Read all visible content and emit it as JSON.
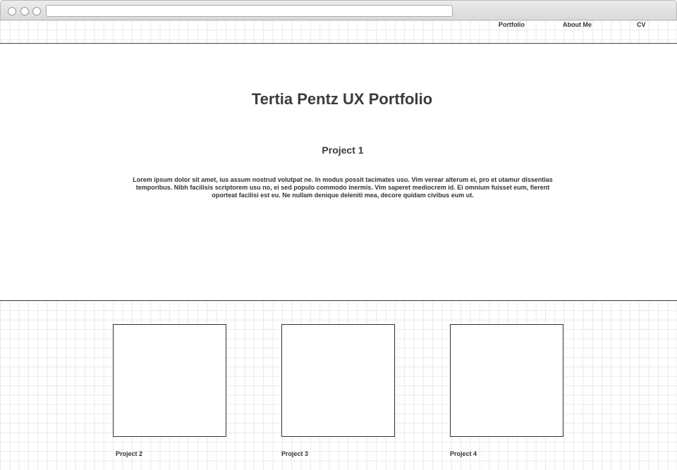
{
  "nav": {
    "portfolio": "Portfolio",
    "about": "About Me",
    "cv": "CV"
  },
  "hero": {
    "title": "Tertia Pentz UX Portfolio",
    "project_title": "Project 1",
    "description": "Lorem ipsum dolor sit amet, ius assum nostrud volutpat ne. In modus possit tacimates usu. Vim verear alterum ei, pro et utamur dissentias temporibus. Nibh facilisis scriptorem usu no, ei sed populo commodo inermis. Vim saperet mediocrem id. Ei omnium fuisset eum, fierent oporteat facilisi est eu. Ne nullam denique deleniti mea, decore quidam civibus eum ut."
  },
  "gallery": {
    "items": [
      {
        "label": "Project 2"
      },
      {
        "label": "Project 3"
      },
      {
        "label": "Project 4"
      }
    ]
  }
}
